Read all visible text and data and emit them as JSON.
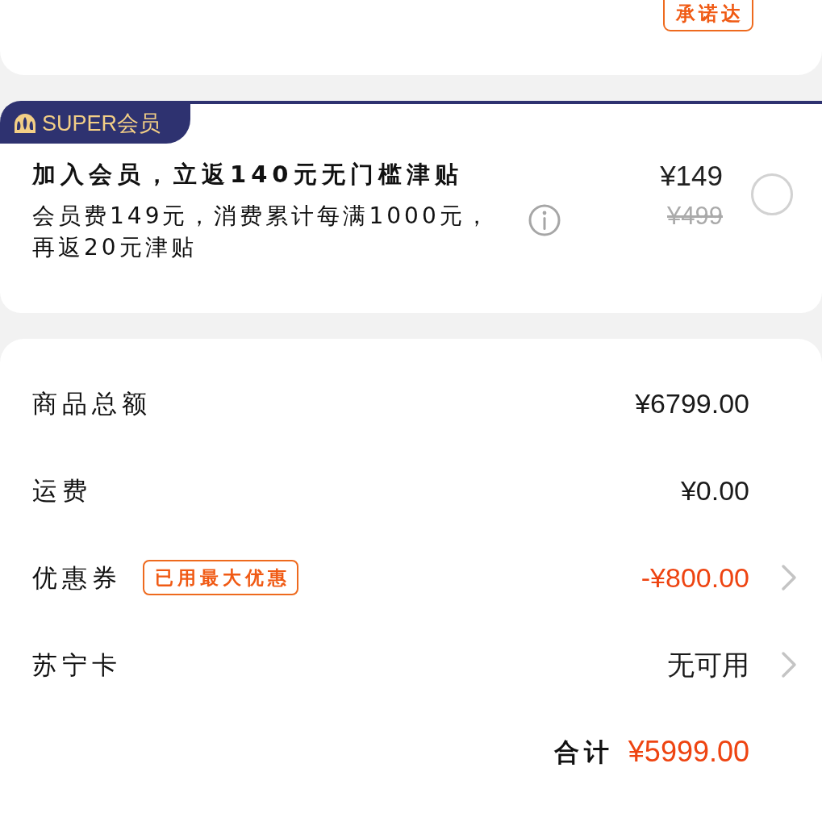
{
  "delivery_card": {
    "tag": "承诺达"
  },
  "membership": {
    "badge": "SUPER会员",
    "title": "加入会员，立返140元无门槛津贴",
    "description": "会员费149元，消费累计每满1000元，再返20元津贴",
    "price": "¥149",
    "original_price": "¥499",
    "selected": false
  },
  "summary": {
    "rows": [
      {
        "kind": "plain",
        "label": "商品总额",
        "value": "¥6799.00",
        "highlight": false
      },
      {
        "kind": "plain",
        "label": "运费",
        "value": "¥0.00",
        "highlight": false
      },
      {
        "kind": "link",
        "label": "优惠券",
        "tag": "已用最大优惠",
        "value": "-¥800.00",
        "highlight": true
      },
      {
        "kind": "link",
        "label": "苏宁卡",
        "value": "无可用",
        "highlight": false
      }
    ],
    "total": {
      "label": "合计",
      "amount": "¥5999.00"
    }
  }
}
